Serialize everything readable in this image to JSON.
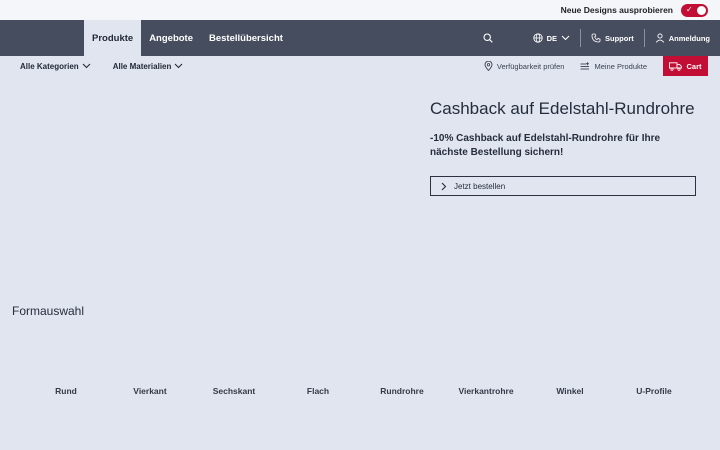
{
  "topbar": {
    "label": "Neue Designs ausprobieren",
    "toggle_on": true,
    "accent": "#c20e35"
  },
  "nav": {
    "tabs": [
      {
        "label": "Produkte",
        "active": true
      },
      {
        "label": "Angebote",
        "active": false
      },
      {
        "label": "Bestellübersicht",
        "active": false
      }
    ],
    "language": "DE",
    "support": "Support",
    "login": "Anmeldung"
  },
  "subnav": {
    "categories": "Alle Kategorien",
    "materials": "Alle Materialien",
    "availability": "Verfügbarkeit prüfen",
    "my_products": "Meine Produkte",
    "cart": "Cart"
  },
  "hero": {
    "title": "Cashback auf Edelstahl-Rundrohre",
    "subtitle": "-10% Cashback auf Edelstahl-Rundrohre für Ihre nächste Bestellung sichern!",
    "cta": "Jetzt bestellen"
  },
  "shapes": {
    "title": "Formauswahl",
    "items": [
      "Rund",
      "Vierkant",
      "Sechskant",
      "Flach",
      "Rundrohre",
      "Vierkantrohre",
      "Winkel",
      "U-Profile"
    ]
  }
}
